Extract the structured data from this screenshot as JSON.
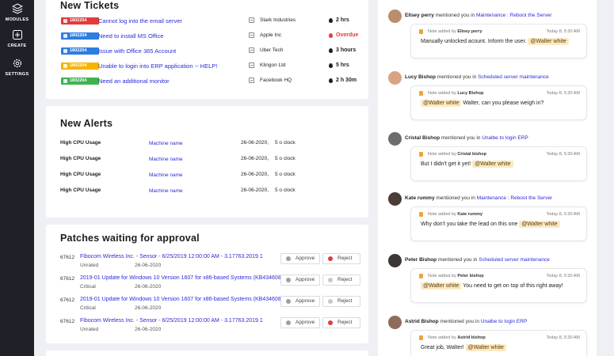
{
  "sidebar": {
    "items": [
      {
        "label": "MODULES",
        "icon": "layers-icon"
      },
      {
        "label": "CREATE",
        "icon": "plus-square-icon"
      },
      {
        "label": "SETTINGS",
        "icon": "gear-icon"
      }
    ]
  },
  "tickets": {
    "title": "New Tickets",
    "rows": [
      {
        "id": "1802204",
        "priority_color": "#e23b3b",
        "title": "Cannot log into the email server",
        "org": "Stark Industries",
        "time": "2 hrs",
        "time_color": "#1b1d22"
      },
      {
        "id": "1802204",
        "priority_color": "#2f7de1",
        "title": "Need to install MS Office",
        "org": "Apple Inc",
        "time": "Overdue",
        "time_color": "#e23b3b"
      },
      {
        "id": "1802204",
        "priority_color": "#2f7de1",
        "title": "Issue with Office 365 Account",
        "org": "Uber Tech",
        "time": "3 hours",
        "time_color": "#1b1d22"
      },
      {
        "id": "1802204",
        "priority_color": "#f5b400",
        "title": "Unable to login into ERP application -- HELP!",
        "org": "Klingon Ltd",
        "time": "5 hrs",
        "time_color": "#1b1d22"
      },
      {
        "id": "1802204",
        "priority_color": "#3fb34f",
        "title": "Need an additional monitor",
        "org": "Facebook HQ",
        "time": "2 h 30m",
        "time_color": "#1b1d22"
      }
    ]
  },
  "alerts": {
    "title": "New Alerts",
    "rows": [
      {
        "type": "High CPU Usage",
        "machine": "Machine name",
        "date": "26-06-2020,",
        "clock": "5 o clock"
      },
      {
        "type": "High CPU Usage",
        "machine": "Machine name",
        "date": "26-06-2020,",
        "clock": "5 o clock"
      },
      {
        "type": "High CPU Usage",
        "machine": "Machine name",
        "date": "26-06-2020,",
        "clock": "5 o clock"
      },
      {
        "type": "High CPU Usage",
        "machine": "Machine name",
        "date": "26-06-2020,",
        "clock": "5 o clock"
      }
    ]
  },
  "patches": {
    "title": "Patches waiting for approval",
    "approve_label": "Approve",
    "reject_label": "Reject",
    "rows": [
      {
        "id": "67612",
        "title": "Fibocom Wireless Inc. - Sensor - 6/25/2019 12:00:00 AM - 3.17763.2019.1",
        "rating": "Unrated",
        "date": "26-06-2020"
      },
      {
        "id": "67612",
        "title": "2019-01 Update for Windows 10 Version 1607 for x86-based Systems (KB4346087)",
        "rating": "Critical",
        "date": "26-06-2020"
      },
      {
        "id": "67612",
        "title": "2019-01 Update for Windows 10 Version 1607 for x86-based Systems (KB4346087)",
        "rating": "Critical",
        "date": "26-06-2020"
      },
      {
        "id": "67612",
        "title": "Fibocom Wireless Inc. - Sensor - 6/25/2019 12:00:00 AM - 3.17763.2019.1",
        "rating": "Unrated",
        "date": "26-06-2020"
      }
    ]
  },
  "mentions": [
    {
      "who": "Ellsey perry",
      "mid": "mentioned you in",
      "link": "Maintenance : Reboot the Server",
      "note_by": "Ellsey perry",
      "time": "Today 8, 5:30 AM",
      "text_before": "Manually unlocked acount. Inform the user.",
      "tag": "@Walter white",
      "text_after": "",
      "tag_first": false,
      "avatar_color": "#b98d6e"
    },
    {
      "who": "Lucy Bishop",
      "mid": "mentioned you in",
      "link": "Scheduled server maintenance",
      "note_by": "Lucy Bishop",
      "time": "Today 8, 5:30 AM",
      "text_before": "",
      "tag": "@Walter white",
      "text_after": "Walter, can you please weigh in?",
      "tag_first": true,
      "avatar_color": "#d9a383"
    },
    {
      "who": "Cristal Bishop",
      "mid": "mentioned you in",
      "link": "Unalbe to login ERP",
      "note_by": "Cristal bishop",
      "time": "Today 8, 5:30 AM",
      "text_before": "But I didn't get it yet!",
      "tag": "@Walter white",
      "text_after": "",
      "tag_first": false,
      "avatar_color": "#6d6d6d"
    },
    {
      "who": "Kate rummy",
      "mid": "mentioned you in",
      "link": "Maintenance : Reboot the Server",
      "note_by": "Kate rummy",
      "time": "Today 8, 5:30 AM",
      "text_before": "Why don't you take the lead on this one",
      "tag": "@Walter white",
      "text_after": "",
      "tag_first": false,
      "avatar_color": "#4a3c37"
    },
    {
      "who": "Peter Bishop",
      "mid": "mentioned you in",
      "link": "Scheduled server maintenance",
      "note_by": "Peter bishop",
      "time": "Today 8, 5:30 AM",
      "text_before": "",
      "tag": "@Walter white",
      "text_after": "You need to get on top of this right away!",
      "tag_first": true,
      "avatar_color": "#3b3534"
    },
    {
      "who": "Astrid Bishop",
      "mid": "mentioned you in",
      "link": "Unalbe to login ERP",
      "note_by": "Astrid bishop",
      "time": "Today 8, 5:30 AM",
      "text_before": "Great job, Walter!",
      "tag": "@Walter white",
      "text_after": "",
      "tag_first": false,
      "avatar_color": "#8e6b5a"
    }
  ]
}
